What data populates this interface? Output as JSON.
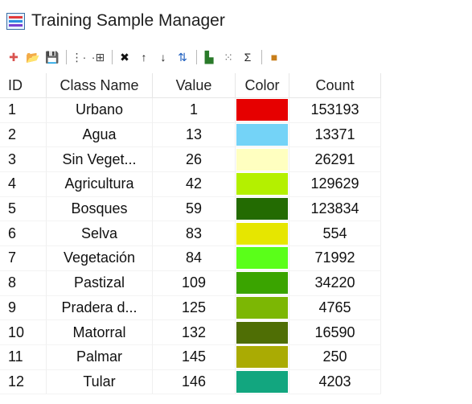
{
  "window": {
    "title": "Training Sample Manager"
  },
  "toolbar": {
    "buttons": [
      {
        "name": "new-sample-icon",
        "glyph": "✚",
        "color": "#d9534f"
      },
      {
        "name": "open-folder-icon",
        "glyph": "📂",
        "color": "#d9a400"
      },
      {
        "name": "save-icon",
        "glyph": "💾",
        "color": "#222"
      },
      {
        "name": "merge-classes-icon",
        "glyph": "⋮·",
        "color": "#444"
      },
      {
        "name": "split-class-icon",
        "glyph": "·⊞",
        "color": "#444"
      },
      {
        "name": "delete-icon",
        "glyph": "✖",
        "color": "#111"
      },
      {
        "name": "move-up-icon",
        "glyph": "↑",
        "color": "#111"
      },
      {
        "name": "move-down-icon",
        "glyph": "↓",
        "color": "#111"
      },
      {
        "name": "sort-icon",
        "glyph": "⇅",
        "color": "#1f5fbf"
      },
      {
        "name": "histogram-icon",
        "glyph": "▙",
        "color": "#2a7a2a"
      },
      {
        "name": "scatterplot-icon",
        "glyph": "⁙",
        "color": "#777"
      },
      {
        "name": "statistics-sigma-icon",
        "glyph": "Σ",
        "color": "#222"
      },
      {
        "name": "apply-colors-icon",
        "glyph": "■",
        "color": "#c87e1a"
      }
    ]
  },
  "table": {
    "columns": [
      "ID",
      "Class Name",
      "Value",
      "Color",
      "Count"
    ],
    "rows": [
      {
        "id": "1",
        "name": "Urbano",
        "value": "1",
        "color": "#e60000",
        "count": "153193"
      },
      {
        "id": "2",
        "name": "Agua",
        "value": "13",
        "color": "#74d3f7",
        "count": "13371"
      },
      {
        "id": "3",
        "name": "Sin Veget...",
        "value": "26",
        "color": "#ffffc0",
        "count": "26291"
      },
      {
        "id": "4",
        "name": "Agricultura",
        "value": "42",
        "color": "#b4f000",
        "count": "129629"
      },
      {
        "id": "5",
        "name": "Bosques",
        "value": "59",
        "color": "#236b02",
        "count": "123834"
      },
      {
        "id": "6",
        "name": "Selva",
        "value": "83",
        "color": "#e6e600",
        "count": "554"
      },
      {
        "id": "7",
        "name": "Vegetación",
        "value": "84",
        "color": "#5aff19",
        "count": "71992"
      },
      {
        "id": "8",
        "name": "Pastizal",
        "value": "109",
        "color": "#3aa400",
        "count": "34220"
      },
      {
        "id": "9",
        "name": "Pradera d...",
        "value": "125",
        "color": "#7cb704",
        "count": "4765"
      },
      {
        "id": "10",
        "name": "Matorral",
        "value": "132",
        "color": "#4f6e05",
        "count": "16590"
      },
      {
        "id": "11",
        "name": "Palmar",
        "value": "145",
        "color": "#aaab03",
        "count": "250"
      },
      {
        "id": "12",
        "name": "Tular",
        "value": "146",
        "color": "#12a67f",
        "count": "4203"
      }
    ]
  }
}
